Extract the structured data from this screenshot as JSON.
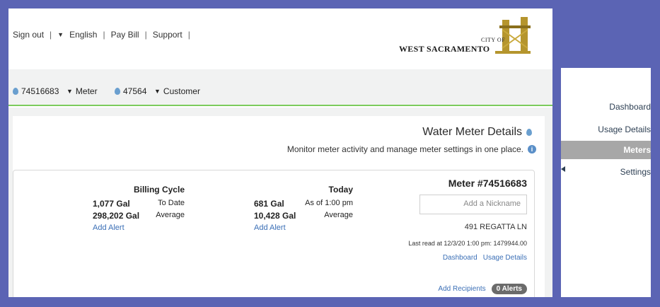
{
  "top_links": {
    "sign_out": "Sign out",
    "language": "English",
    "pay_bill": "Pay Bill",
    "support": "Support"
  },
  "logo": {
    "line1": "CITY OF",
    "line2": "WEST SACRAMENTO"
  },
  "sub_bar": {
    "meter_number": "74516683",
    "meter_label": "Meter",
    "customer_number": "47564",
    "customer_label": "Customer"
  },
  "panel": {
    "title": "Water Meter Details",
    "description": "Monitor meter activity and manage meter settings in one place."
  },
  "meter_card": {
    "heading": "Meter #74516683",
    "nickname_placeholder": "Add a Nickname",
    "address": "491 REGATTA LN",
    "last_read": "Last read at 12/3/20 1:00 pm: 1479944.00",
    "links": {
      "usage_details": "Usage Details",
      "dashboard": "Dashboard"
    },
    "alerts_badge": "0 Alerts",
    "add_recipients": "Add Recipients",
    "today": {
      "heading": "Today",
      "row1_label": "As of 1:00 pm",
      "row1_value": "681 Gal",
      "row2_label": "Average",
      "row2_value": "10,428 Gal",
      "add_alert": "Add Alert"
    },
    "billing": {
      "heading": "Billing Cycle",
      "row1_label": "To Date",
      "row1_value": "1,077 Gal",
      "row2_label": "Average",
      "row2_value": "298,202 Gal",
      "add_alert": "Add Alert"
    }
  },
  "sidebar": {
    "items": [
      {
        "label": "Dashboard"
      },
      {
        "label": "Usage Details"
      },
      {
        "label": "Meters"
      },
      {
        "label": "Settings"
      }
    ]
  },
  "colors": {
    "frame": "#5b64b4",
    "accent_green": "#7ccb5c",
    "link_blue": "#3b6fb6"
  }
}
